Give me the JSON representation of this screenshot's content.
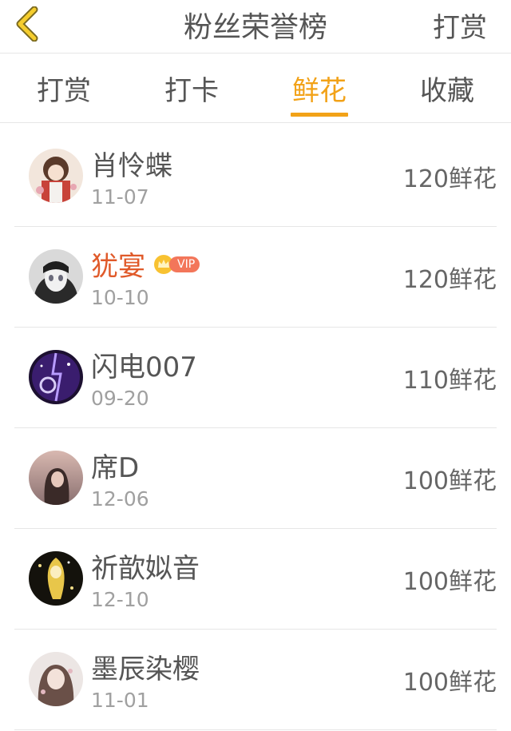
{
  "header": {
    "title": "粉丝荣誉榜",
    "action_label": "打赏",
    "accent_color": "#f2a218"
  },
  "tabs": [
    {
      "label": "打赏",
      "active": false
    },
    {
      "label": "打卡",
      "active": false
    },
    {
      "label": "鲜花",
      "active": true
    },
    {
      "label": "收藏",
      "active": false
    }
  ],
  "fans": [
    {
      "name": "肖怜蝶",
      "date": "11-07",
      "amount": "120鲜花",
      "vip": false
    },
    {
      "name": "犹宴",
      "date": "10-10",
      "amount": "120鲜花",
      "vip": true,
      "badge": "VIP"
    },
    {
      "name": "闪电007",
      "date": "09-20",
      "amount": "110鲜花",
      "vip": false
    },
    {
      "name": "席D",
      "date": "12-06",
      "amount": "100鲜花",
      "vip": false
    },
    {
      "name": "祈歆姒音",
      "date": "12-10",
      "amount": "100鲜花",
      "vip": false
    },
    {
      "name": "墨辰染樱",
      "date": "11-01",
      "amount": "100鲜花",
      "vip": false
    }
  ]
}
